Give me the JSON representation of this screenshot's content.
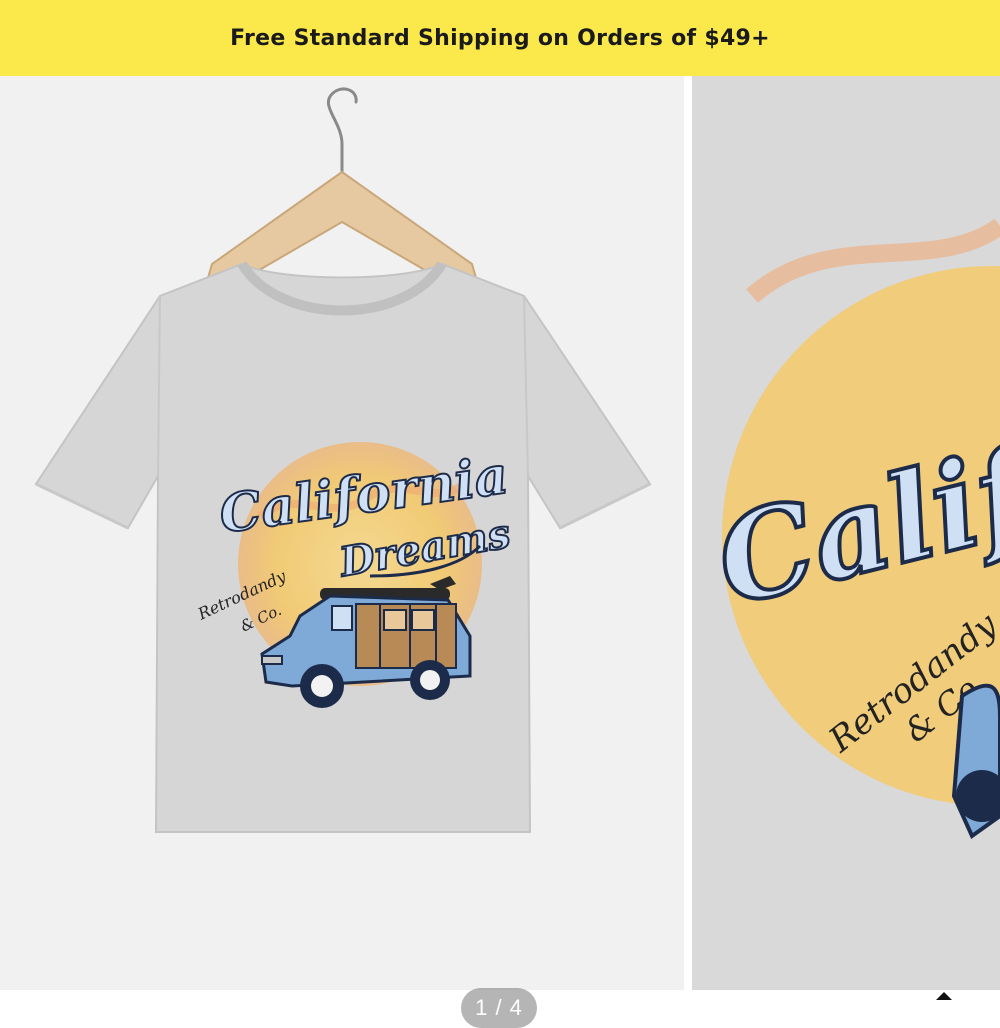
{
  "banner": {
    "text": "Free Standard Shipping on Orders of $49+",
    "background": "#fbe94c"
  },
  "product": {
    "print": {
      "title_line1": "California",
      "title_line2": "Dreams",
      "brand_line1": "Retrodandy",
      "brand_line2": "& Co."
    },
    "tshirt_color": "#d6d6d6",
    "sun_color": "#f4c96a",
    "car_color": "#7fa9d6"
  },
  "gallery": {
    "current": "1",
    "total": "4",
    "counter_text": "1 / 4"
  }
}
